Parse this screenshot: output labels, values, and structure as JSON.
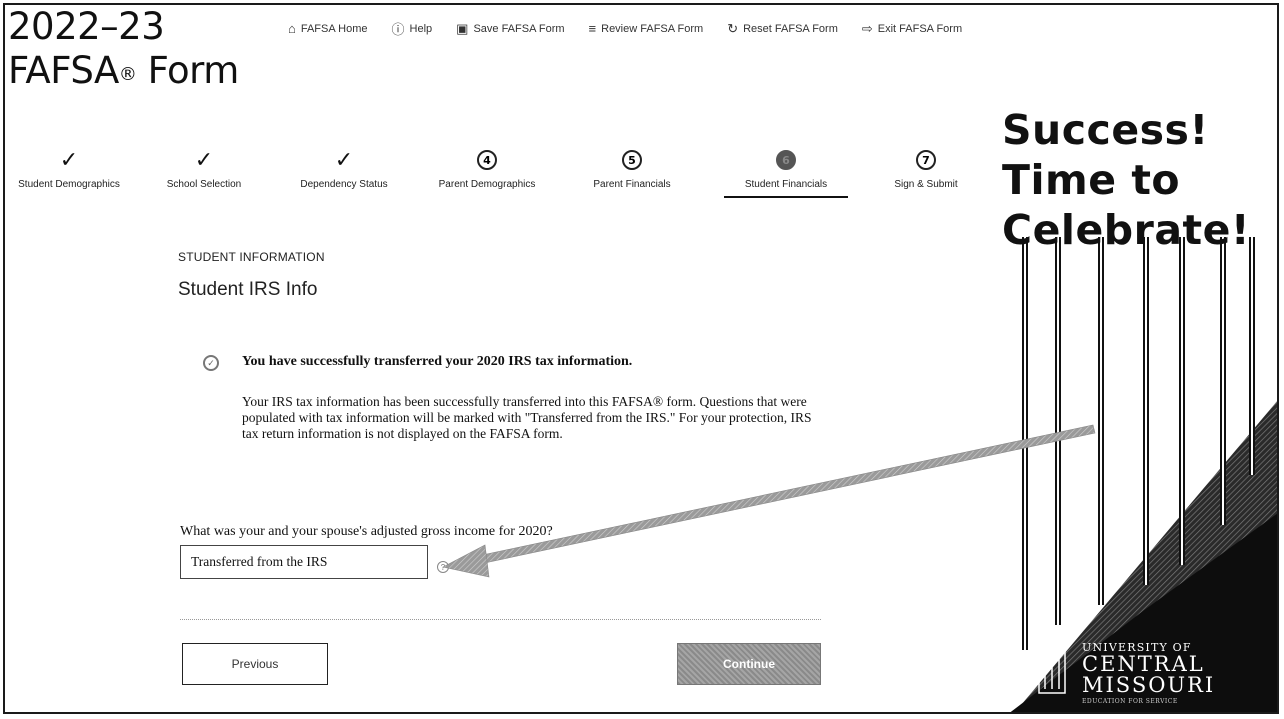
{
  "app": {
    "title_line1": "2022–23",
    "title_line2": "FAFSA",
    "title_reg": "®",
    "title_word": " Form"
  },
  "toolbar": {
    "items": [
      {
        "label": "FAFSA Home",
        "icon": "home-icon"
      },
      {
        "label": "Help",
        "icon": "help-icon"
      },
      {
        "label": "Save FAFSA Form",
        "icon": "save-icon"
      },
      {
        "label": "Review FAFSA Form",
        "icon": "list-icon"
      },
      {
        "label": "Reset FAFSA Form",
        "icon": "reset-icon"
      },
      {
        "label": "Exit FAFSA Form",
        "icon": "exit-icon"
      }
    ]
  },
  "steps": [
    {
      "label": "Student Demographics",
      "state": "done"
    },
    {
      "label": "School Selection",
      "state": "done"
    },
    {
      "label": "Dependency Status",
      "state": "done"
    },
    {
      "label": "Parent Demographics",
      "state": "todo",
      "number": "4"
    },
    {
      "label": "Parent Financials",
      "state": "todo",
      "number": "5"
    },
    {
      "label": "Student Financials",
      "state": "active",
      "number": "6"
    },
    {
      "label": "Sign & Submit",
      "state": "todo",
      "number": "7"
    }
  ],
  "main": {
    "section_label": "STUDENT INFORMATION",
    "heading": "Student IRS Info",
    "success_title": "You have successfully transferred your 2020 IRS tax information.",
    "success_body": "Your IRS tax information has been successfully transferred into this FAFSA® form. Questions that were populated with tax information will be marked with \"Transferred from the IRS.\" For your protection, IRS tax return information is not displayed on the FAFSA form.",
    "question": "What was your and your spouse's adjusted gross income for 2020?",
    "agi_value": "Transferred from the IRS",
    "previous_label": "Previous",
    "continue_label": "Continue"
  },
  "overlay": {
    "celebrate": "Success!\nTime to\nCelebrate!",
    "university_line1": "UNIVERSITY OF",
    "university_line2": "CENTRAL",
    "university_line3": "MISSOURI",
    "university_tagline": "EDUCATION FOR SERVICE"
  },
  "colors": {
    "banner_black": "#111111",
    "arrow_gray": "#9a9a9a",
    "continue_gray": "#999999"
  }
}
